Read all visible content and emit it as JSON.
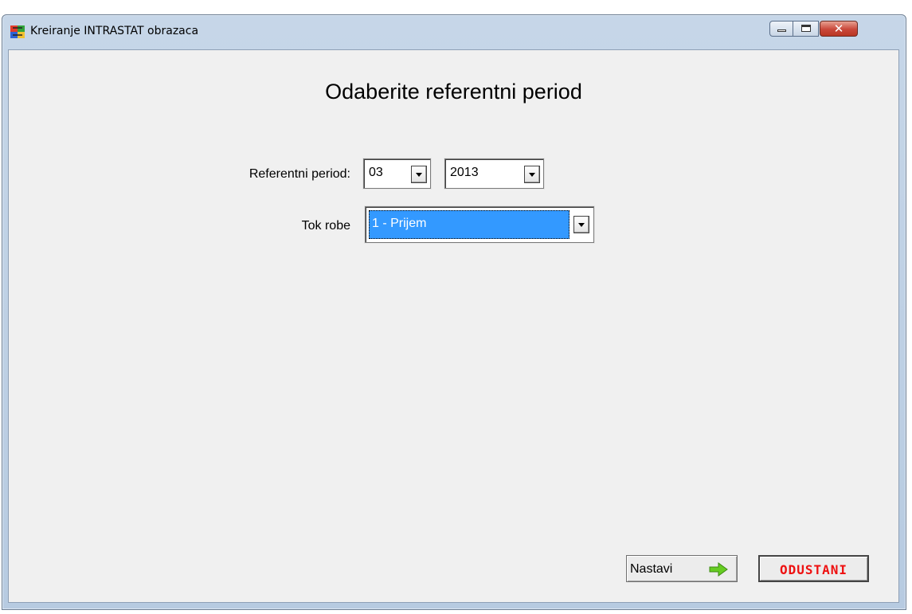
{
  "window": {
    "title": "Kreiranje INTRASTAT obrazaca",
    "icon": "app-icon",
    "controls": [
      "minimize-icon",
      "maximize-icon",
      "close-icon"
    ]
  },
  "form": {
    "heading": "Odaberite referentni period",
    "period_label": "Referentni period:",
    "month_value": "03",
    "year_value": "2013",
    "flow_label": "Tok robe",
    "flow_value": "1 - Prijem"
  },
  "buttons": {
    "next_label": "Nastavi",
    "cancel_label": "ODUSTANI"
  },
  "colors": {
    "selection": "#3399ff",
    "cancel_text": "#ee1111",
    "next_arrow": "#66cc22"
  }
}
